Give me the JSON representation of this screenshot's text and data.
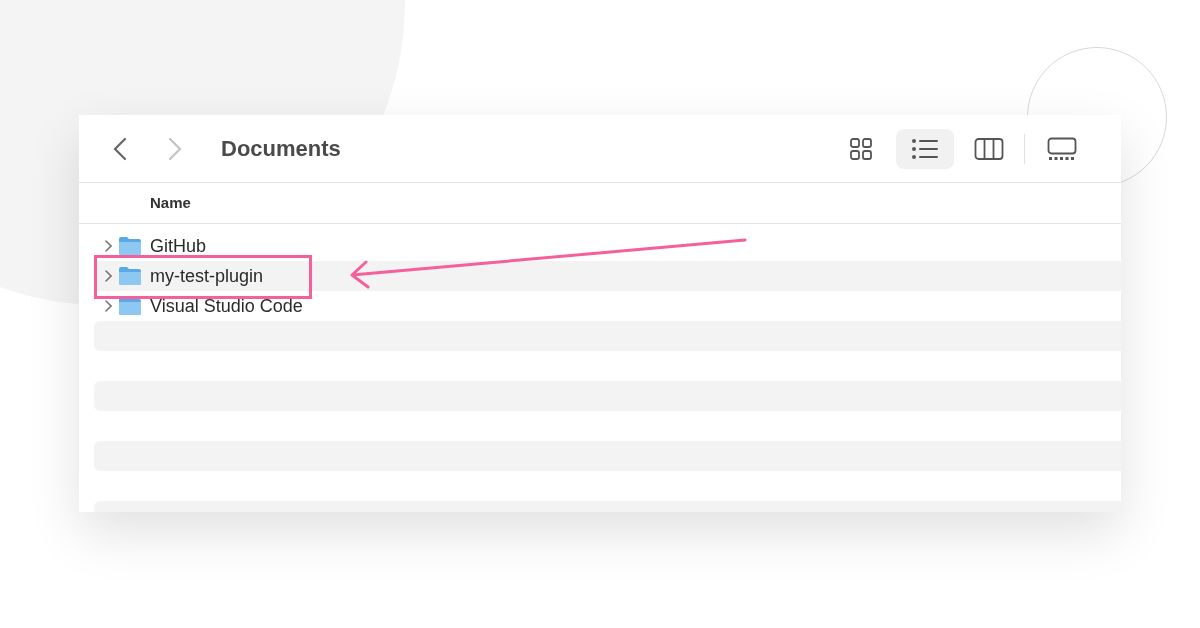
{
  "window": {
    "title": "Documents"
  },
  "navigation": {
    "back": {
      "disabled": false
    },
    "forward": {
      "disabled": true
    }
  },
  "view_modes": [
    {
      "kind": "icons",
      "selected": false
    },
    {
      "kind": "list",
      "selected": true
    },
    {
      "kind": "columns",
      "selected": false
    },
    {
      "kind": "gallery",
      "selected": false
    }
  ],
  "table": {
    "columns": [
      "Name"
    ],
    "rows": [
      {
        "name": "GitHub",
        "expanded": false,
        "highlighted": false
      },
      {
        "name": "my-test-plugin",
        "expanded": false,
        "highlighted": true
      },
      {
        "name": "Visual Studio Code",
        "expanded": false,
        "highlighted": false
      }
    ]
  }
}
